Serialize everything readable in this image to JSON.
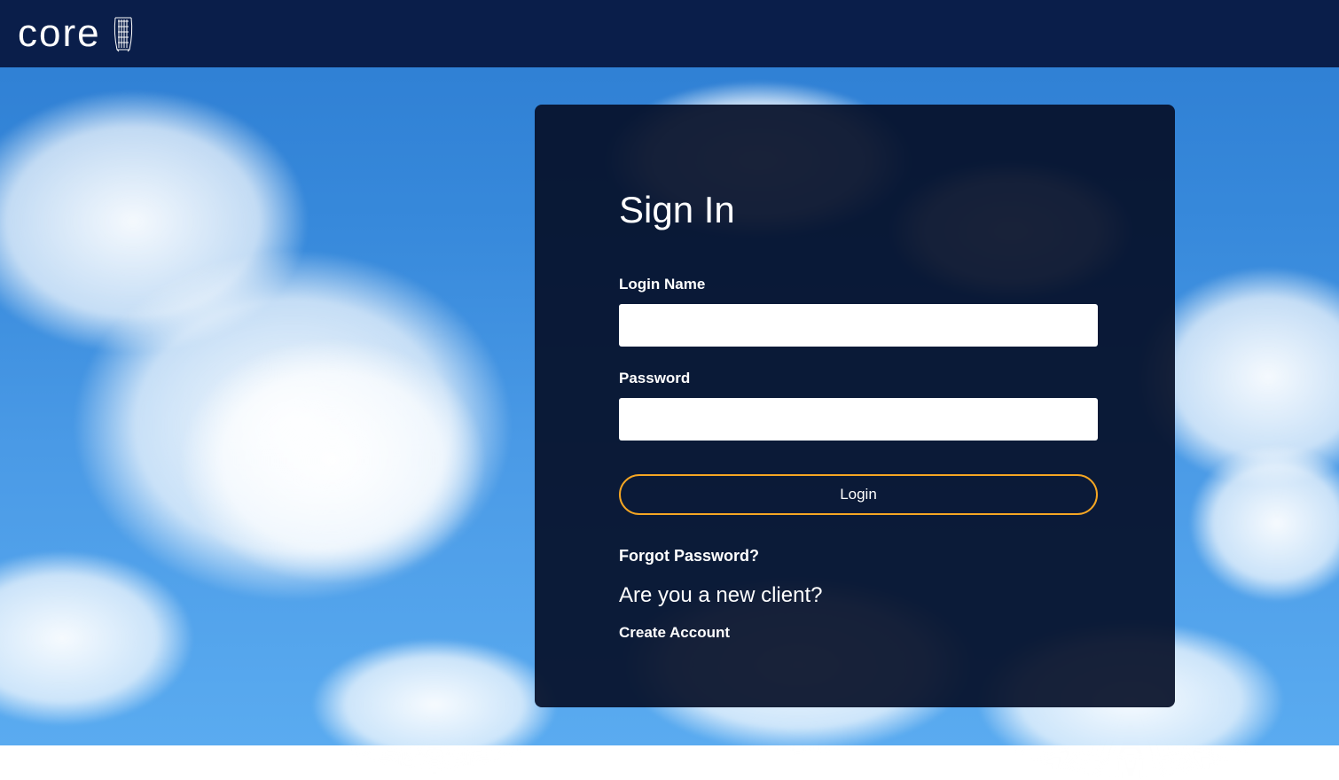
{
  "header": {
    "logo_text": "core"
  },
  "login": {
    "title": "Sign In",
    "login_name_label": "Login Name",
    "login_name_value": "",
    "password_label": "Password",
    "password_value": "",
    "login_button": "Login",
    "forgot_password": "Forgot Password?",
    "new_client_prompt": "Are you a new client?",
    "create_account": "Create Account"
  },
  "colors": {
    "header_bg": "#0a1e4a",
    "card_bg": "rgba(5, 15, 40, 0.92)",
    "accent": "#f5a623",
    "sky_top": "#2d7dd2",
    "sky_bottom": "#5aabf0"
  }
}
